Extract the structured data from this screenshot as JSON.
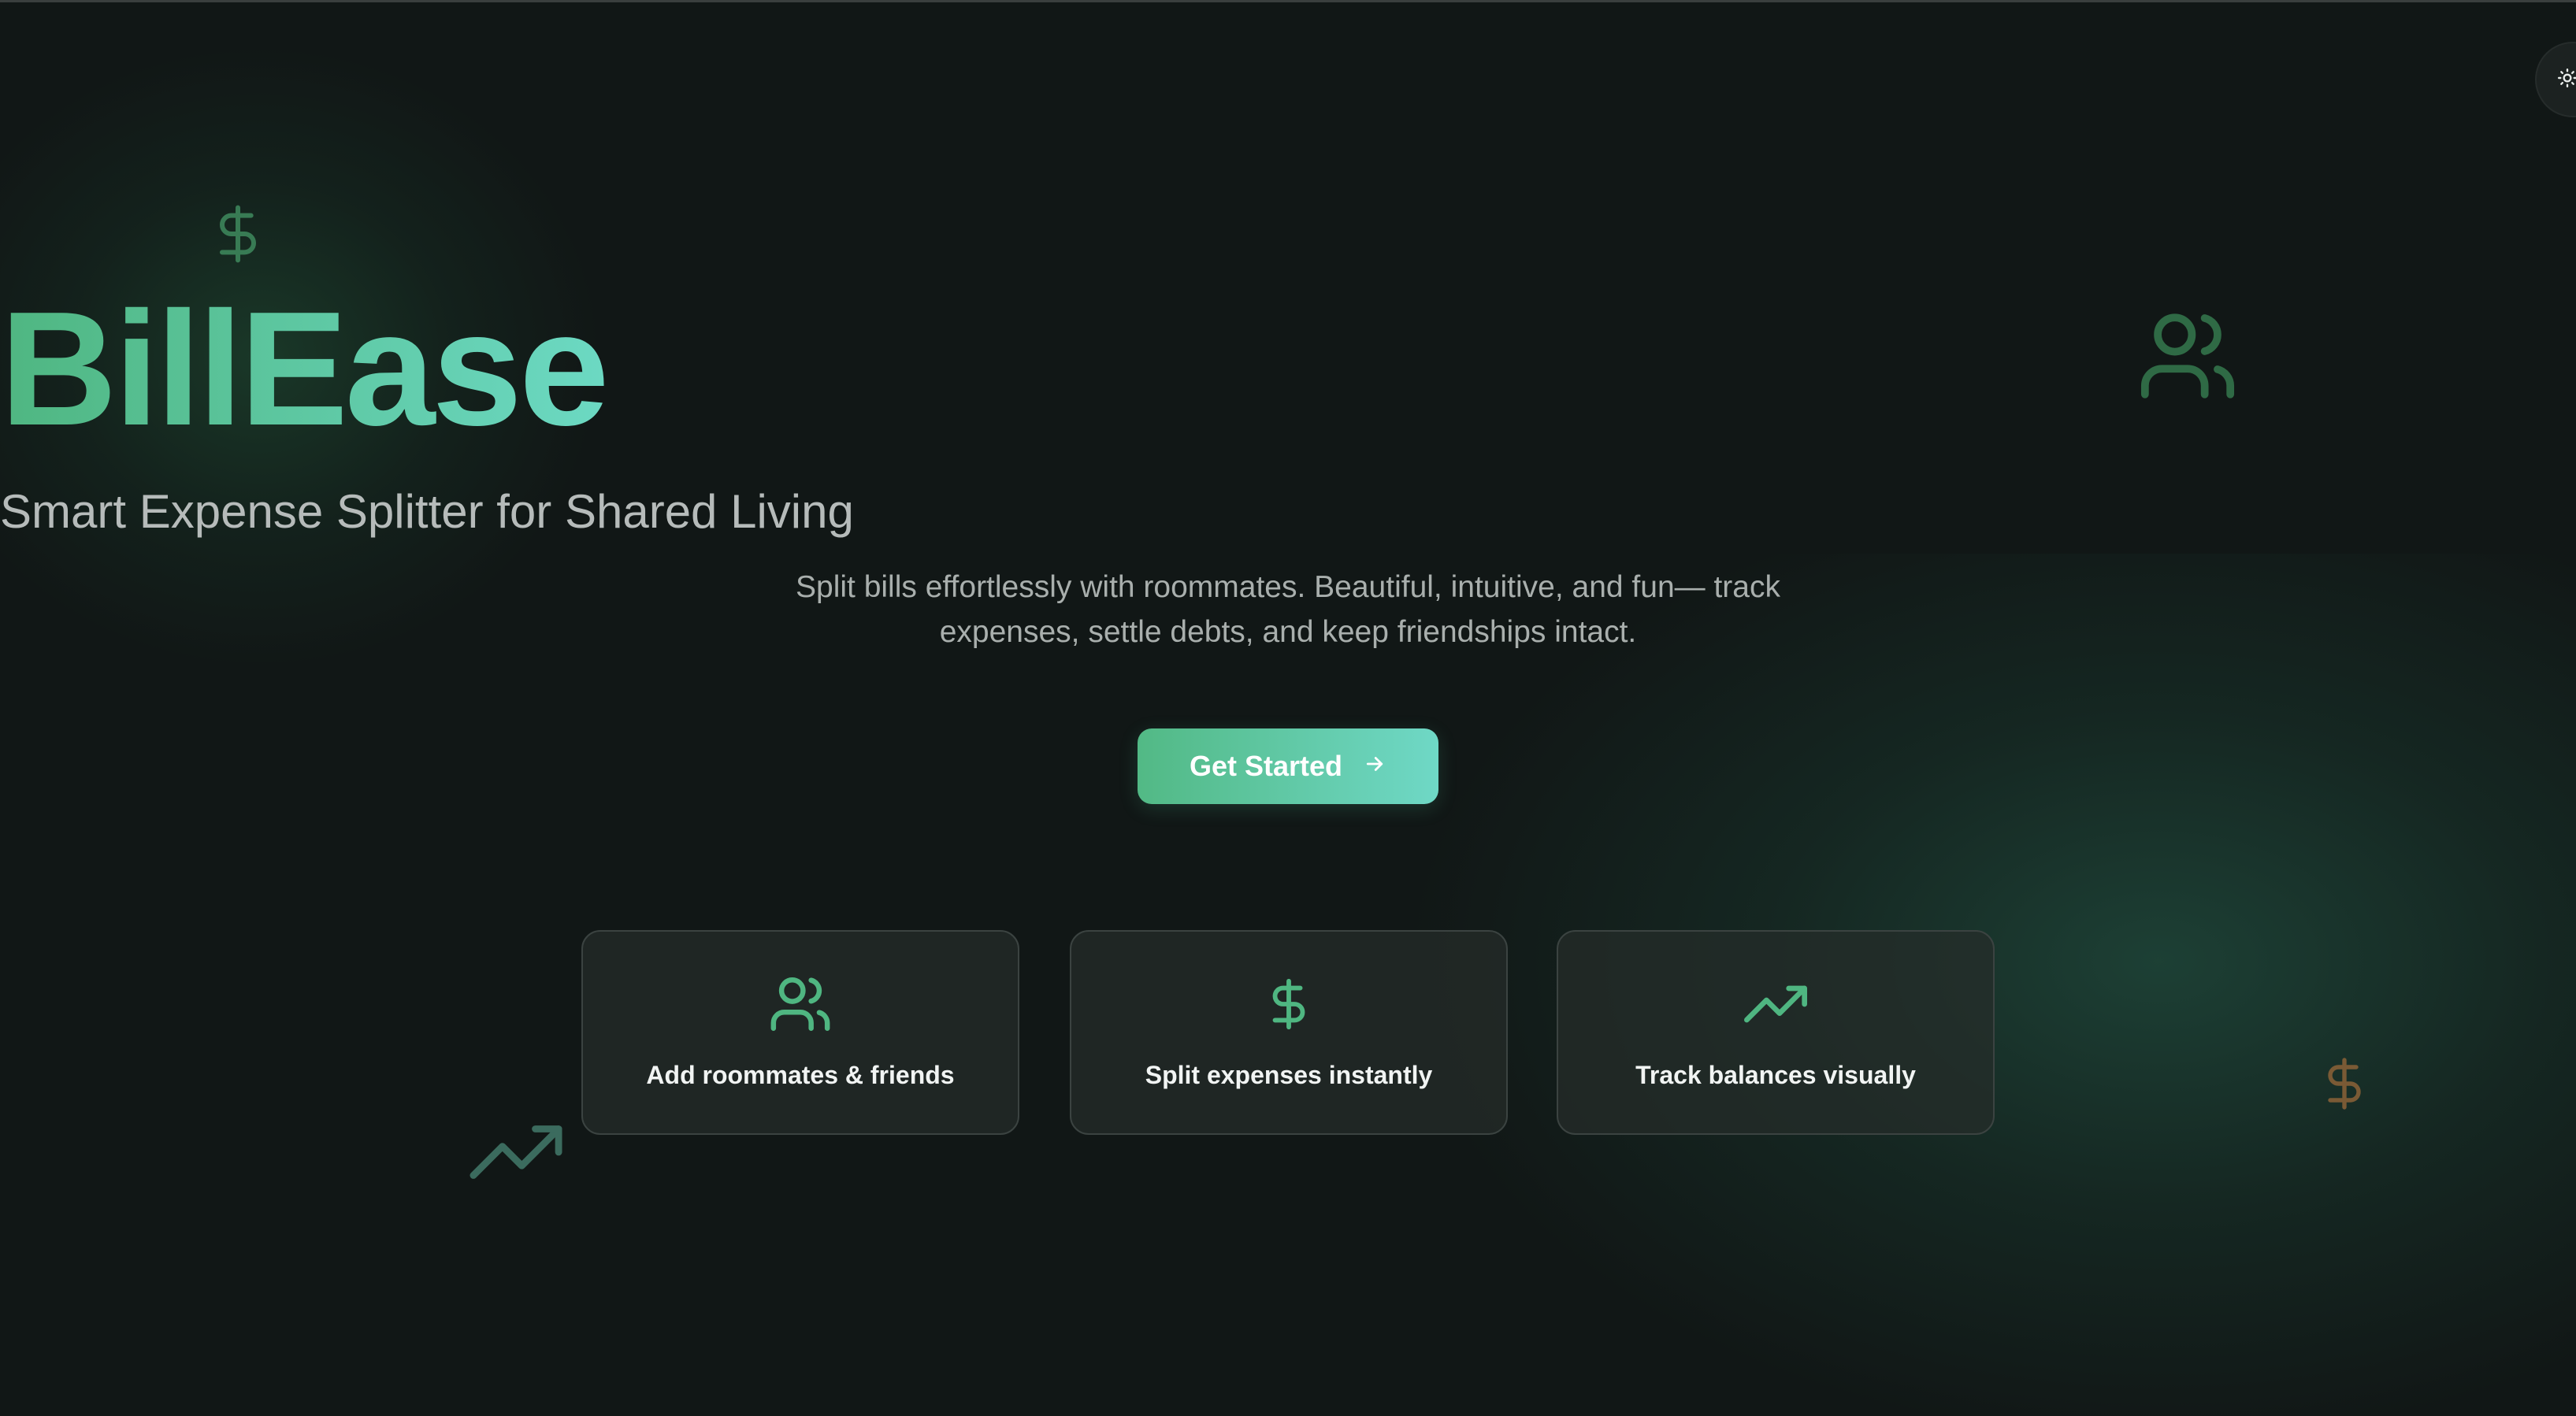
{
  "theme_toggle": {
    "icon": "sun-icon"
  },
  "hero": {
    "title": "BillEase",
    "subtitle": "Smart Expense Splitter for Shared Living",
    "description": "Split bills effortlessly with roommates. Beautiful, intuitive, and fun— track expenses, settle debts, and keep friendships intact.",
    "cta_label": "Get Started",
    "cta_icon": "arrow-right-icon"
  },
  "features": [
    {
      "icon": "users-icon",
      "label": "Add roommates & friends"
    },
    {
      "icon": "dollar-sign-icon",
      "label": "Split expenses instantly"
    },
    {
      "icon": "trending-up-icon",
      "label": "Track balances visually"
    }
  ],
  "decorations": [
    {
      "icon": "dollar-sign-icon",
      "color": "#3f8a5e"
    },
    {
      "icon": "users-icon",
      "color": "#2f6a45"
    },
    {
      "icon": "trending-up-icon",
      "color": "#3b6b5e"
    },
    {
      "icon": "dollar-sign-icon",
      "color": "#7a5a35"
    }
  ],
  "colors": {
    "background": "#111716",
    "accent_start": "#4fb681",
    "accent_end": "#6cd9c3"
  }
}
